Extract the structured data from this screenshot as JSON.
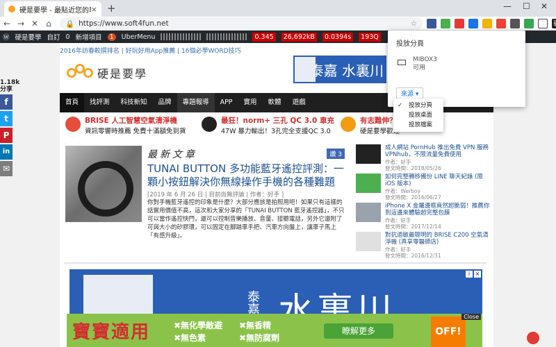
{
  "browser": {
    "tab_title": "硬是要學 - 最貼近您的專業 3C 資",
    "tab_close": "×",
    "new_tab": "+",
    "window_controls": [
      "—",
      "☐",
      "✕"
    ],
    "url": "https://www.soft4fun.net",
    "nav_icons": [
      "←",
      "→",
      "✕",
      "⌂"
    ]
  },
  "admin_bar": {
    "site_name": "硬是要學",
    "customize": "自訂",
    "comments_count": "0",
    "new_item": "新增項目",
    "notifications": "1",
    "uber_menu": "UberMenu",
    "stats": [
      "0.345",
      "26,692kB",
      "0.0394s",
      "193Q"
    ]
  },
  "site": {
    "top_links": [
      "2016年訪春較撰排名",
      "好玩好用App推薦",
      "16個必學WORD技巧"
    ],
    "logo_text": "硬是要學",
    "banner_text": "泰嘉 水裏川",
    "menu": [
      "首頁",
      "找評測",
      "科技新知",
      "品牌",
      "專題報導",
      "APP",
      "實用",
      "軟體",
      "遊戲"
    ],
    "promos": [
      {
        "title": "BRISE 人工智慧空氣清淨機",
        "sub": "資訊零響時推薦 免費十滿額免到貨"
      },
      {
        "title": "最狂！norm+ 三孔 QC 3.0 車充",
        "sub": "47W 暴力輸出！3孔完全支援QC 3.0"
      },
      {
        "title": "有志難伸？",
        "sub": "硬是要學歡迎"
      }
    ]
  },
  "featured": {
    "section_title": "最新文章",
    "like_label": "讚 3",
    "title": "TUNAI BUTTON 多功能藍牙遙控評測：一顆小按鈕解決你無線操作手機的各種難題",
    "meta": "[2019 年 6 月 26 日 | 目前尚無評論 | 作者：好手 ]",
    "excerpt": "你對手機藍牙遙控的印象是什麼？大部分應該是拍照用吧！如果只有這樣的話實用價值不高，這次和大家分享的「TUNAI BUTTON 藍牙遙控器」，不只可以當作遙控快門，還可以控制音樂播放、音量、接聽電話，另外它還附了可與大小的矽膠環，可以固定在腳踏車手把、汽車方向盤上，讓車子馬上「有感升級」。"
  },
  "sidebar": [
    {
      "title": "成人網站 PornHub 推出免費 VPN 服務 VPNhub，不限流量免費使用",
      "author": "作者：好手",
      "date": "發文時間：2018/05/26"
    },
    {
      "title": "如何完整轉移備份 LINE 聊天紀錄 (限 iOS 版本)",
      "author": "作者：Werboy",
      "date": "發文時間：2016/06/27"
    },
    {
      "title": "iPhone X 金屬邊框竟然超脆弱！推薦你到這邊來體驗超完整包膜",
      "author": "作者：好手",
      "date": "發文時間：2017/12/14"
    },
    {
      "title": "對抗過敏最聰明的 BRISE C200 空氣清淨機 (真享零醫師店)",
      "author": "作者：好手",
      "date": "發文時間：2016/12/31"
    }
  ],
  "share": {
    "count": "1.18k",
    "label": "分享",
    "buttons": [
      {
        "name": "facebook",
        "glyph": "f",
        "color": "#3b5998"
      },
      {
        "name": "twitter",
        "glyph": "t",
        "color": "#1da1f2"
      },
      {
        "name": "pinterest",
        "glyph": "P",
        "color": "#cb2027"
      },
      {
        "name": "linkedin",
        "glyph": "in",
        "color": "#0077b5"
      },
      {
        "name": "email",
        "glyph": "✉",
        "color": "#7d7d7d"
      }
    ]
  },
  "big_ad": {
    "text": "水裏川",
    "prefix": "泰嘉"
  },
  "bottom_ad": {
    "headline": "寶寶適用",
    "features": [
      "✖無化學敵避",
      "✖無香精",
      "✖無色素",
      "✖無防腐劑"
    ],
    "cta": "瞭解更多",
    "close": "Close",
    "brand": "OFF!"
  },
  "cast_popup": {
    "title": "投放分頁",
    "device_name": "MIBOX3",
    "device_status": "可用",
    "source_label": "來源 ▾",
    "options": [
      "投放分頁",
      "投放桌面",
      "投放檔案"
    ],
    "checked": "投放分頁"
  }
}
